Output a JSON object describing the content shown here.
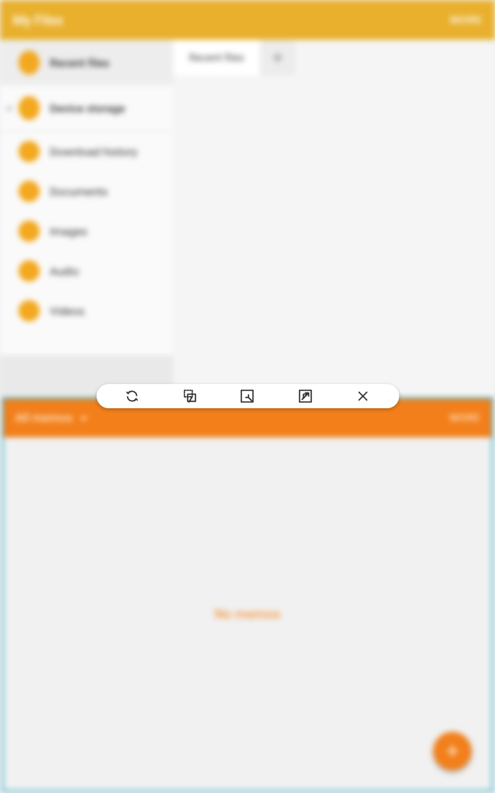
{
  "files_app": {
    "title": "My Files",
    "more_label": "MORE",
    "sidebar": {
      "items": [
        {
          "label": "Recent files"
        },
        {
          "label": "Device storage"
        },
        {
          "label": "Download history"
        },
        {
          "label": "Documents"
        },
        {
          "label": "Images"
        },
        {
          "label": "Audio"
        },
        {
          "label": "Videos"
        }
      ]
    },
    "tabs": {
      "active_label": "Recent files"
    }
  },
  "memo_app": {
    "dropdown_label": "All memos",
    "more_label": "MORE",
    "empty_text": "No memos"
  },
  "colors": {
    "files_accent": "#e8b02d",
    "memo_accent": "#f27f1a",
    "focus_ring": "#1fa9c6"
  }
}
